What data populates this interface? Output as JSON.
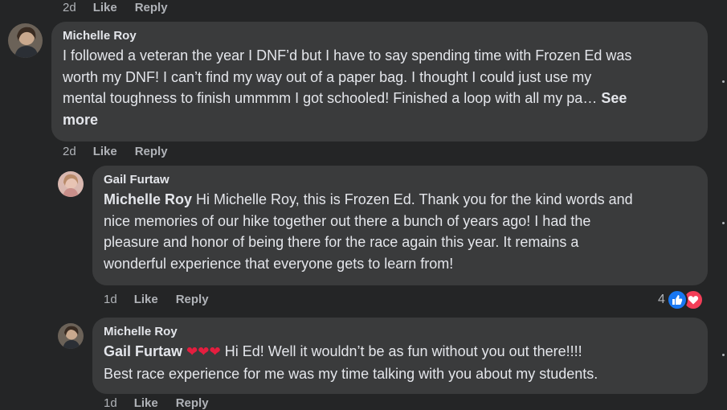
{
  "top_meta": {
    "time": "2d",
    "like": "Like",
    "reply": "Reply"
  },
  "comment1": {
    "author": "Michelle Roy",
    "lines": [
      "I followed a veteran the year I DNF’d but I have to say spending time with Frozen Ed was",
      "worth my DNF! I can’t find my way out of a paper bag. I thought I could just use my",
      "mental toughness to finish ummmm I got schooled! Finished a loop with all my pa… "
    ],
    "see_more": "See",
    "see_more_2": "more",
    "meta": {
      "time": "2d",
      "like": "Like",
      "reply": "Reply"
    }
  },
  "reply1": {
    "author": "Gail Furtaw",
    "mention": "Michelle Roy",
    "line1_rest": " Hi Michelle Roy, this is Frozen Ed. Thank you for the kind words and",
    "lines": [
      "nice memories of our hike together out there a bunch of years ago! I had the",
      "pleasure and honor of being there for the race again this year. It remains a",
      "wonderful experience that everyone gets to learn from!"
    ],
    "meta": {
      "time": "1d",
      "like": "Like",
      "reply": "Reply"
    },
    "reaction_count": "4",
    "reactions": [
      "like-icon",
      "love-icon"
    ]
  },
  "reply2": {
    "author": "Michelle Roy",
    "mention": "Gail Furtaw",
    "hearts": "❤❤❤",
    "line1_rest": " Hi Ed! Well it wouldn’t be as fun without you out there!!!!",
    "line2": "Best race experience for me was my time talking with you about my students.",
    "meta": {
      "time": "1d",
      "like": "Like",
      "reply": "Reply"
    }
  },
  "colors": {
    "background": "#242526",
    "bubble": "#3a3b3c",
    "text": "#e4e6eb",
    "muted": "#b0b3b8",
    "like_blue": "#1877f2",
    "love_red": "#f33e58"
  }
}
